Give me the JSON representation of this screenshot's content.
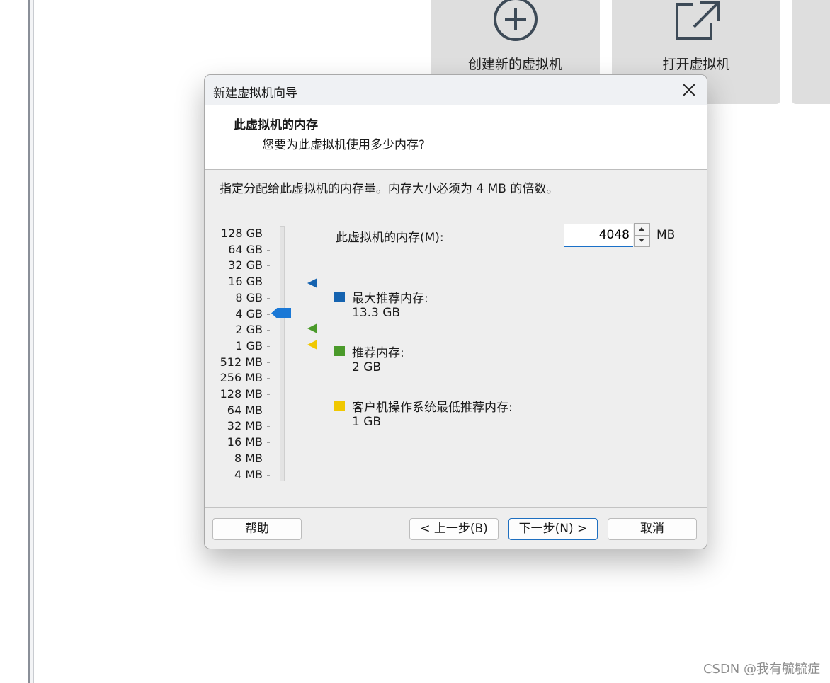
{
  "background": {
    "tiles": [
      {
        "label": "创建新的虚拟机",
        "icon": "plus-circle-icon"
      },
      {
        "label": "打开虚拟机",
        "icon": "open-external-icon"
      },
      {
        "label": "",
        "icon": ""
      }
    ],
    "watermark": "CSDN @我有毓毓症"
  },
  "dialog": {
    "title": "新建虚拟机向导",
    "header_title": "此虚拟机的内存",
    "header_subtitle": "您要为此虚拟机使用多少内存?",
    "description": "指定分配给此虚拟机的内存量。内存大小必须为 4 MB 的倍数。",
    "scale": [
      "128 GB",
      "64 GB",
      "32 GB",
      "16 GB",
      "8 GB",
      "4 GB",
      "2 GB",
      "1 GB",
      "512 MB",
      "256 MB",
      "128 MB",
      "64 MB",
      "32 MB",
      "16 MB",
      "8 MB",
      "4 MB"
    ],
    "slider_value": "4 GB",
    "memory_label": "此虚拟机的内存(M):",
    "memory_value": "4048",
    "memory_unit": "MB",
    "legend": [
      {
        "title": "最大推荐内存:",
        "value": "13.3 GB",
        "color": "#1563b0"
      },
      {
        "title": "推荐内存:",
        "value": "2 GB",
        "color": "#4a9a2a"
      },
      {
        "title": "客户机操作系统最低推荐内存:",
        "value": "1 GB",
        "color": "#f0c800"
      }
    ],
    "buttons": {
      "help": "帮助",
      "back": "< 上一步(B)",
      "next": "下一步(N) >",
      "cancel": "取消"
    }
  }
}
